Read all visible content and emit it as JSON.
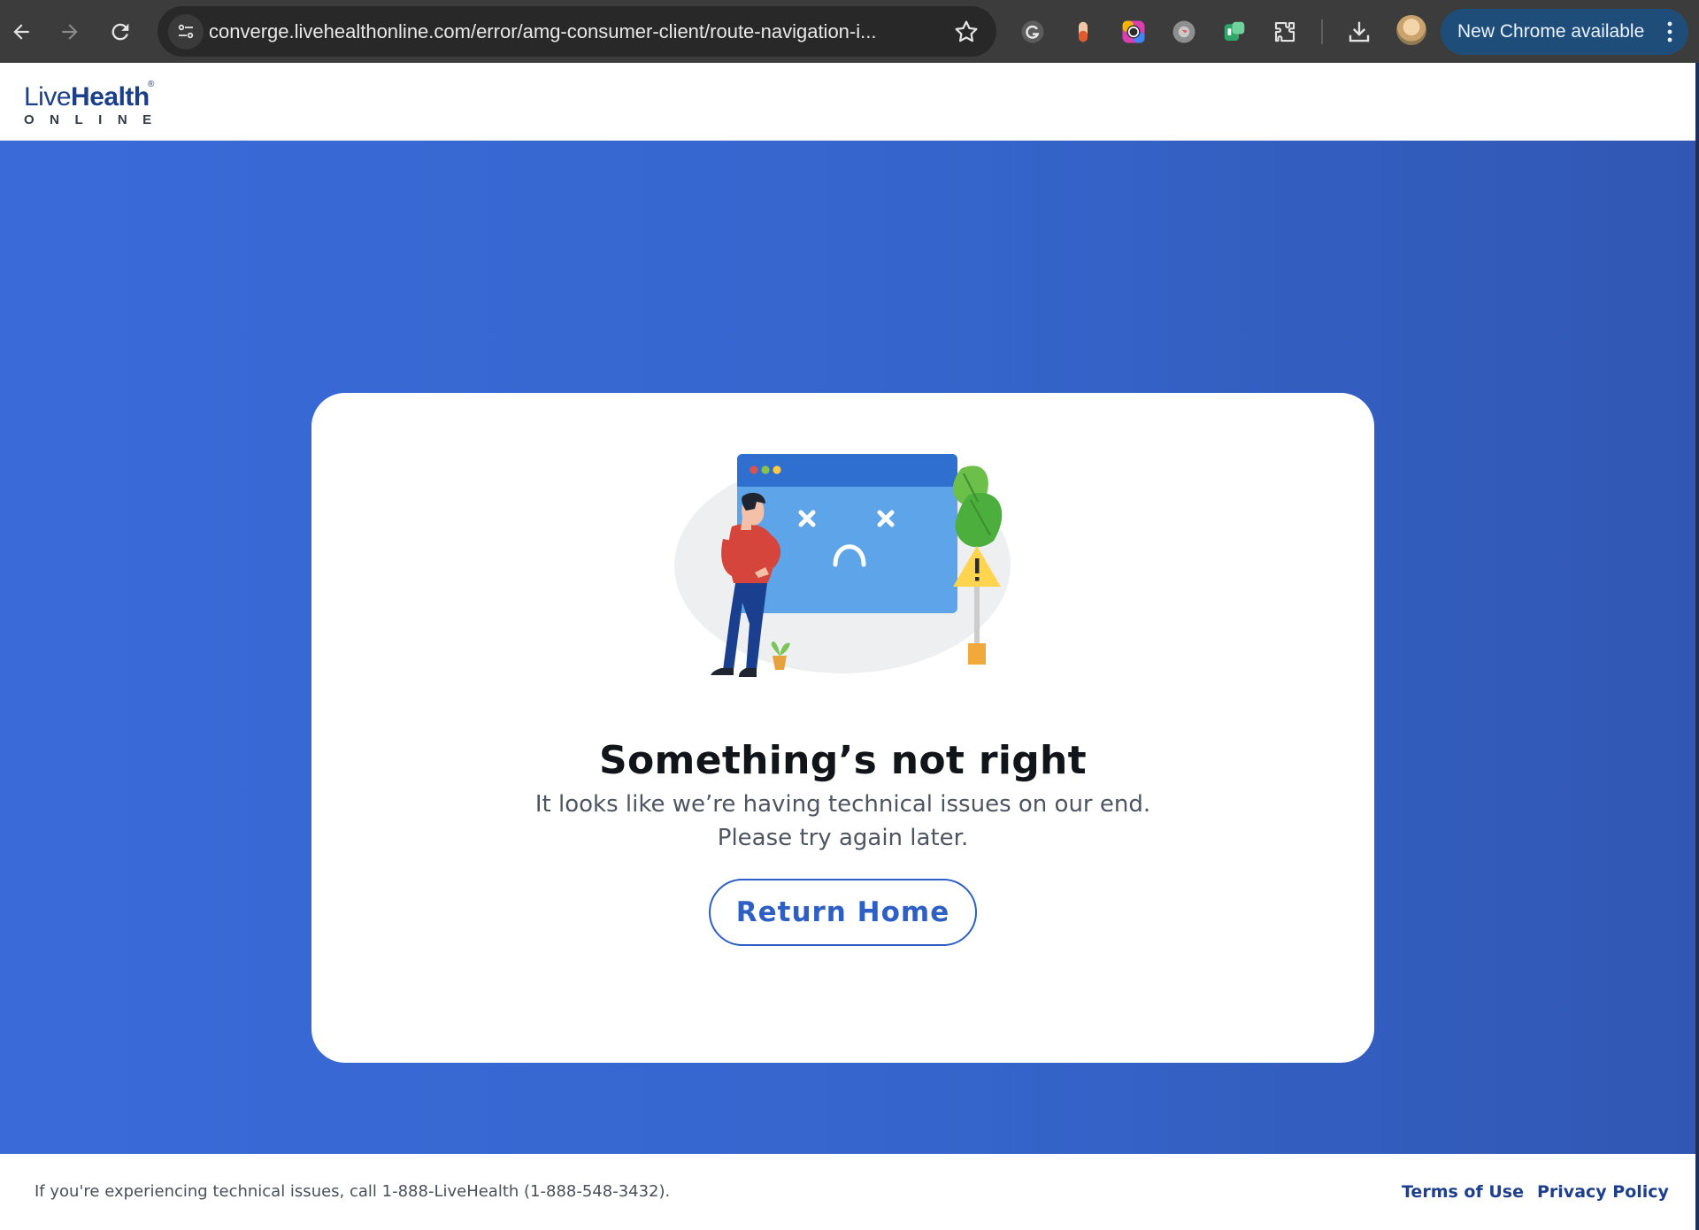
{
  "browser": {
    "url": "converge.livehealthonline.com/error/amg-consumer-client/route-navigation-i...",
    "update_label": "New Chrome available",
    "icons": [
      "back-icon",
      "forward-icon",
      "reload-icon",
      "site-info-icon",
      "bookmark-star-icon",
      "grammarly-extension-icon",
      "extension-icon",
      "color-extension-icon",
      "extension-icon",
      "extension-icon",
      "extensions-puzzle-icon",
      "download-icon",
      "profile-avatar",
      "menu-dots-icon"
    ]
  },
  "header": {
    "logo_light": "Live",
    "logo_bold": "Health",
    "logo_registered": "®",
    "logo_sub": "ONLINE"
  },
  "error_card": {
    "title": "Something’s not right",
    "message_line1": "It looks like we’re having technical issues on our end.",
    "message_line2": "Please try again later.",
    "button_label": "Return Home",
    "illustration_icon": "error-browser-illustration"
  },
  "footer": {
    "support_text": "If you're experiencing technical issues, call 1-888-LiveHealth (1-888-548-3432).",
    "terms_label": "Terms of Use",
    "privacy_label": "Privacy Policy"
  },
  "colors": {
    "chrome_toolbar": "#3c3c3c",
    "omnibox": "#282828",
    "brand_blue": "#1b3f8a",
    "hero_blue": "#3565cc",
    "button_blue": "#2d5fc4",
    "update_chip": "#1f4d7a"
  }
}
